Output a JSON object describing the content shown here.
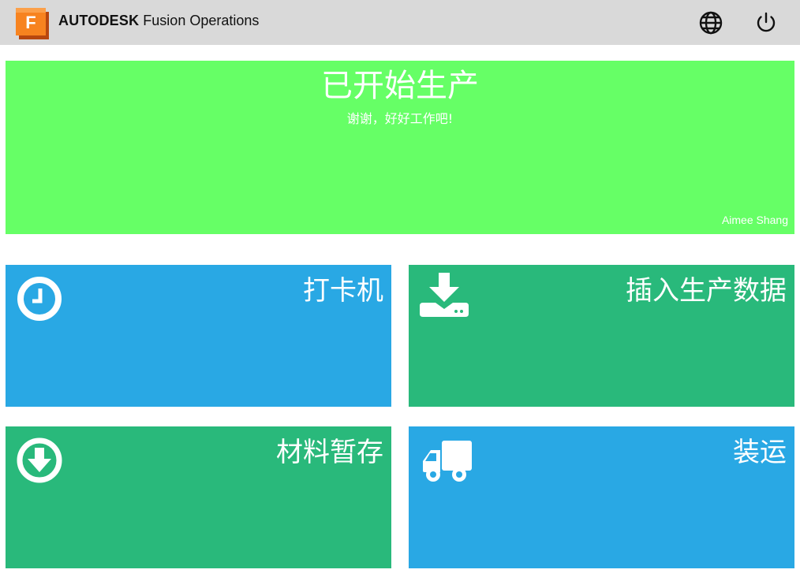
{
  "header": {
    "logo_letter": "F",
    "brand": "AUTODESK",
    "product": "Fusion Operations",
    "icons": [
      "globe-icon",
      "power-icon"
    ]
  },
  "banner": {
    "title": "已开始生产",
    "subtitle": "谢谢，好好工作吧!",
    "user": "Aimee Shang",
    "color": "#66ff66"
  },
  "tiles": [
    {
      "label": "打卡机",
      "icon": "clock-icon",
      "color": "#29a8e4"
    },
    {
      "label": "插入生产数据",
      "icon": "download-tray-icon",
      "color": "#29b97b"
    },
    {
      "label": "材料暂存",
      "icon": "arrow-down-circle-icon",
      "color": "#29b97b"
    },
    {
      "label": "装运",
      "icon": "truck-icon",
      "color": "#29a8e4"
    }
  ]
}
